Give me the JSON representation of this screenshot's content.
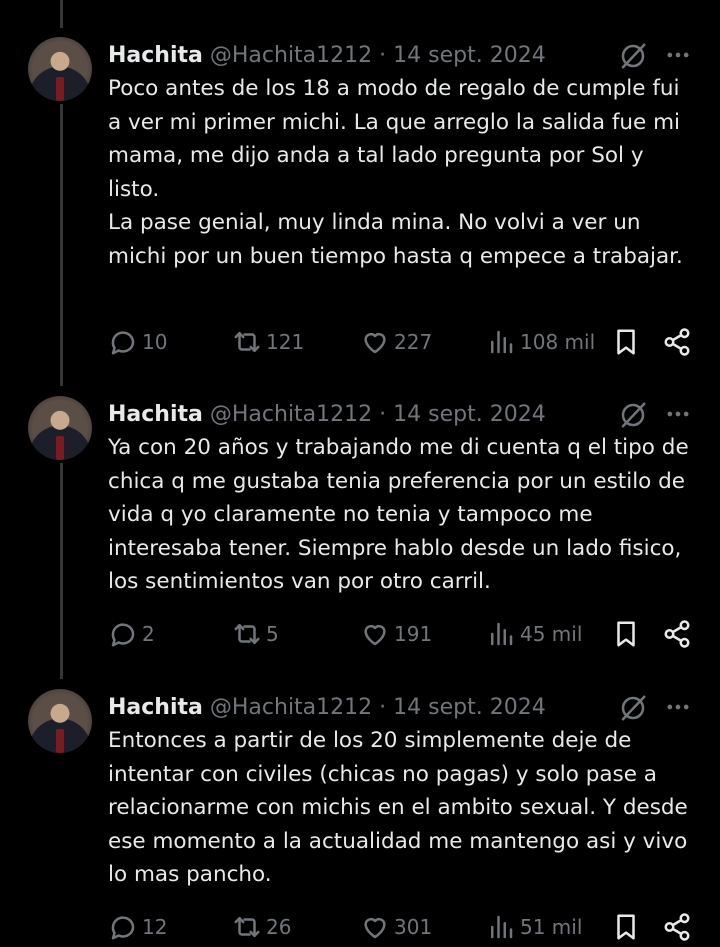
{
  "tweets": [
    {
      "name": "Hachita",
      "handle": "@Hachita1212",
      "sep": "·",
      "date": "14 sept. 2024",
      "text": "Poco antes de los 18 a modo de regalo de cumple fui a ver mi primer michi. La que arreglo la salida fue mi mama, me dijo anda a tal lado pregunta por Sol y listo.\nLa pase genial, muy linda mina. No volvi a ver un michi por un buen tiempo hasta q empece a trabajar.",
      "replies": "10",
      "reposts": "121",
      "likes": "227",
      "views": "108 mil"
    },
    {
      "name": "Hachita",
      "handle": "@Hachita1212",
      "sep": "·",
      "date": "14 sept. 2024",
      "text": "Ya con 20 años y trabajando me di cuenta q el tipo de chica q me gustaba tenia preferencia por un estilo de vida q yo claramente no tenia y tampoco me interesaba tener. Siempre hablo desde un lado fisico, los sentimientos van por otro carril.",
      "replies": "2",
      "reposts": "5",
      "likes": "191",
      "views": "45 mil"
    },
    {
      "name": "Hachita",
      "handle": "@Hachita1212",
      "sep": "·",
      "date": "14 sept. 2024",
      "text": "Entonces a partir de los 20 simplemente deje de intentar con civiles (chicas no pagas) y solo pase a relacionarme con michis en el ambito sexual. Y desde ese momento a la actualidad me mantengo asi y vivo lo mas pancho.",
      "replies": "12",
      "reposts": "26",
      "likes": "301",
      "views": "51 mil"
    }
  ],
  "icons": {
    "reply": "reply-icon",
    "repost": "repost-icon",
    "like": "heart-icon",
    "views": "views-icon",
    "bookmark": "bookmark-icon",
    "share": "share-icon",
    "grok": "grok-icon",
    "more": "more-icon"
  },
  "colors": {
    "background": "#000000",
    "text": "#e7e9ea",
    "muted": "#71767b",
    "thread_line": "#333639"
  }
}
